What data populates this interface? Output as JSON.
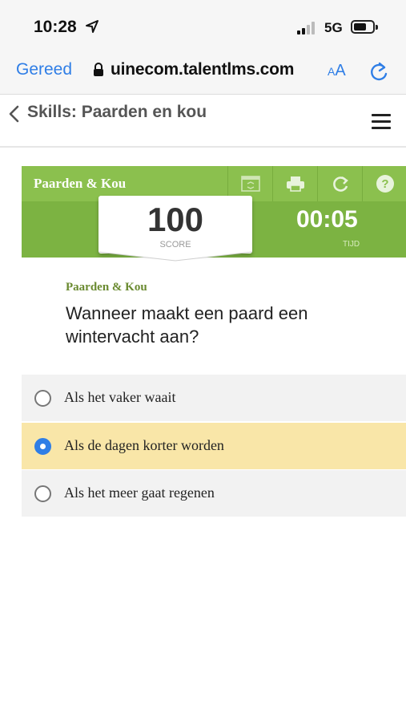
{
  "status_bar": {
    "time": "10:28",
    "network": "5G"
  },
  "browser": {
    "done_label": "Gereed",
    "url": "uinecom.talentlms.com",
    "text_size_label": "AA"
  },
  "course": {
    "title": "Skills: Paarden en kou"
  },
  "quiz": {
    "name": "Paarden & Kou",
    "score": "100",
    "score_label": "SCORE",
    "timer": "00:05",
    "timer_label": "TIJD"
  },
  "question": {
    "category": "Paarden & Kou",
    "text": "Wanneer maakt een paard een wintervacht aan?"
  },
  "answers": [
    {
      "label": "Als het vaker waait",
      "selected": false
    },
    {
      "label": "Als de dagen korter worden",
      "selected": true
    },
    {
      "label": "Als het meer gaat regenen",
      "selected": false
    }
  ],
  "colors": {
    "accent_blue": "#2f7ee6",
    "quiz_green": "#7cb342",
    "selected_answer": "#f9e6a8"
  }
}
